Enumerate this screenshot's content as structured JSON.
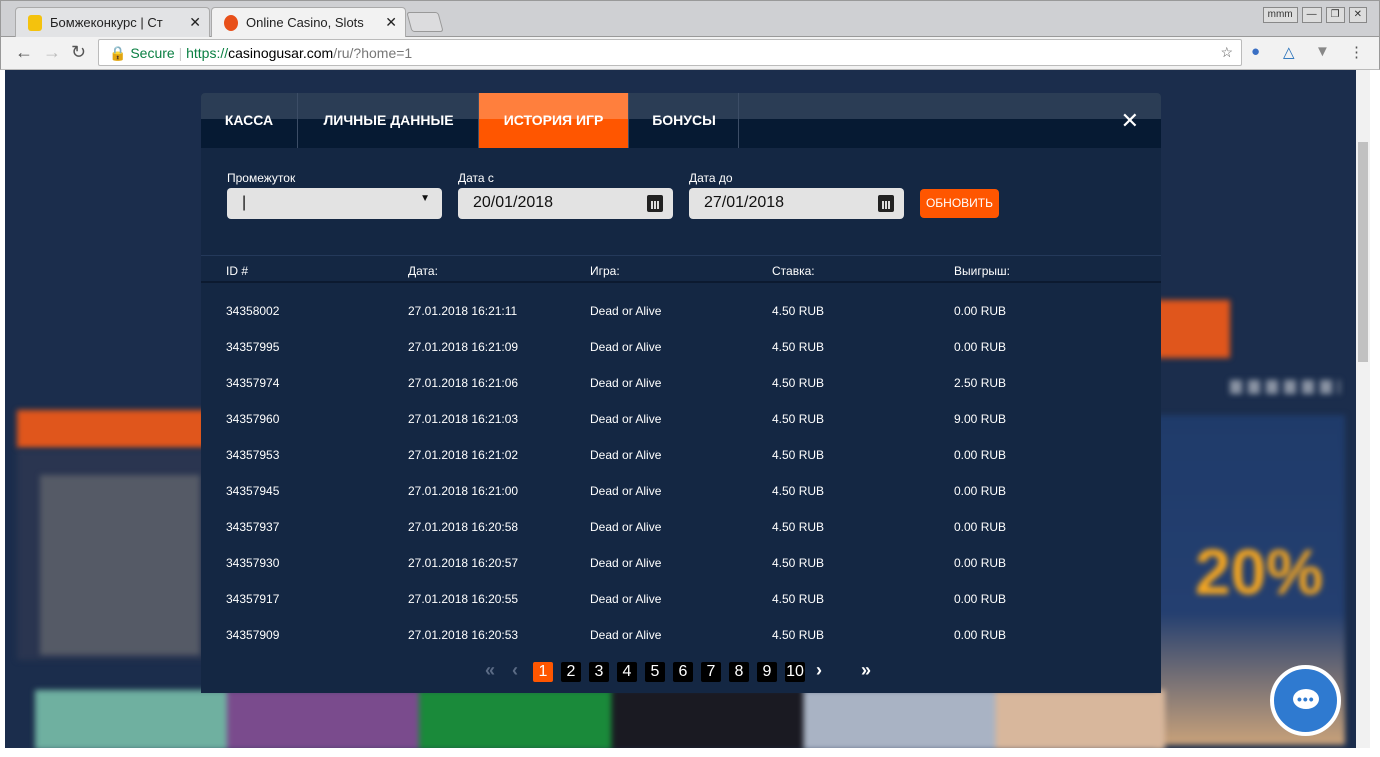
{
  "browser": {
    "tabs": [
      {
        "title": "Бомжеконкурс | Ст"
      },
      {
        "title": "Online Casino, Slots"
      }
    ],
    "profile": "mmm",
    "secure_label": "Secure",
    "url_scheme": "https://",
    "url_host": "casinogusar.com",
    "url_path": "/ru/?home=1"
  },
  "modal": {
    "tabs": [
      "КАССА",
      "ЛИЧНЫЕ ДАННЫЕ",
      "ИСТОРИЯ ИГР",
      "БОНУСЫ"
    ],
    "active_tab": 2,
    "filters": {
      "period_label": "Промежуток",
      "period_value": "|",
      "from_label": "Дата с",
      "from_value": "20/01/2018",
      "to_label": "Дата до",
      "to_value": "27/01/2018",
      "refresh": "ОБНОВИТЬ"
    },
    "columns": [
      "ID #",
      "Дата:",
      "Игра:",
      "Ставка:",
      "Выигрыш:"
    ],
    "rows": [
      [
        "34358002",
        "27.01.2018 16:21:11",
        "Dead or Alive",
        "4.50 RUB",
        "0.00 RUB"
      ],
      [
        "34357995",
        "27.01.2018 16:21:09",
        "Dead or Alive",
        "4.50 RUB",
        "0.00 RUB"
      ],
      [
        "34357974",
        "27.01.2018 16:21:06",
        "Dead or Alive",
        "4.50 RUB",
        "2.50 RUB"
      ],
      [
        "34357960",
        "27.01.2018 16:21:03",
        "Dead or Alive",
        "4.50 RUB",
        "9.00 RUB"
      ],
      [
        "34357953",
        "27.01.2018 16:21:02",
        "Dead or Alive",
        "4.50 RUB",
        "0.00 RUB"
      ],
      [
        "34357945",
        "27.01.2018 16:21:00",
        "Dead or Alive",
        "4.50 RUB",
        "0.00 RUB"
      ],
      [
        "34357937",
        "27.01.2018 16:20:58",
        "Dead or Alive",
        "4.50 RUB",
        "0.00 RUB"
      ],
      [
        "34357930",
        "27.01.2018 16:20:57",
        "Dead or Alive",
        "4.50 RUB",
        "0.00 RUB"
      ],
      [
        "34357917",
        "27.01.2018 16:20:55",
        "Dead or Alive",
        "4.50 RUB",
        "0.00 RUB"
      ],
      [
        "34357909",
        "27.01.2018 16:20:53",
        "Dead or Alive",
        "4.50 RUB",
        "0.00 RUB"
      ]
    ],
    "pages": [
      "1",
      "2",
      "3",
      "4",
      "5",
      "6",
      "7",
      "8",
      "9",
      "10"
    ],
    "current_page": 1,
    "pager_icons": {
      "first": "«",
      "prev": "‹",
      "next": "›",
      "last": "»"
    }
  },
  "background": {
    "promo_percent": "20%"
  },
  "chat_icon": "chat-bubble-icon"
}
